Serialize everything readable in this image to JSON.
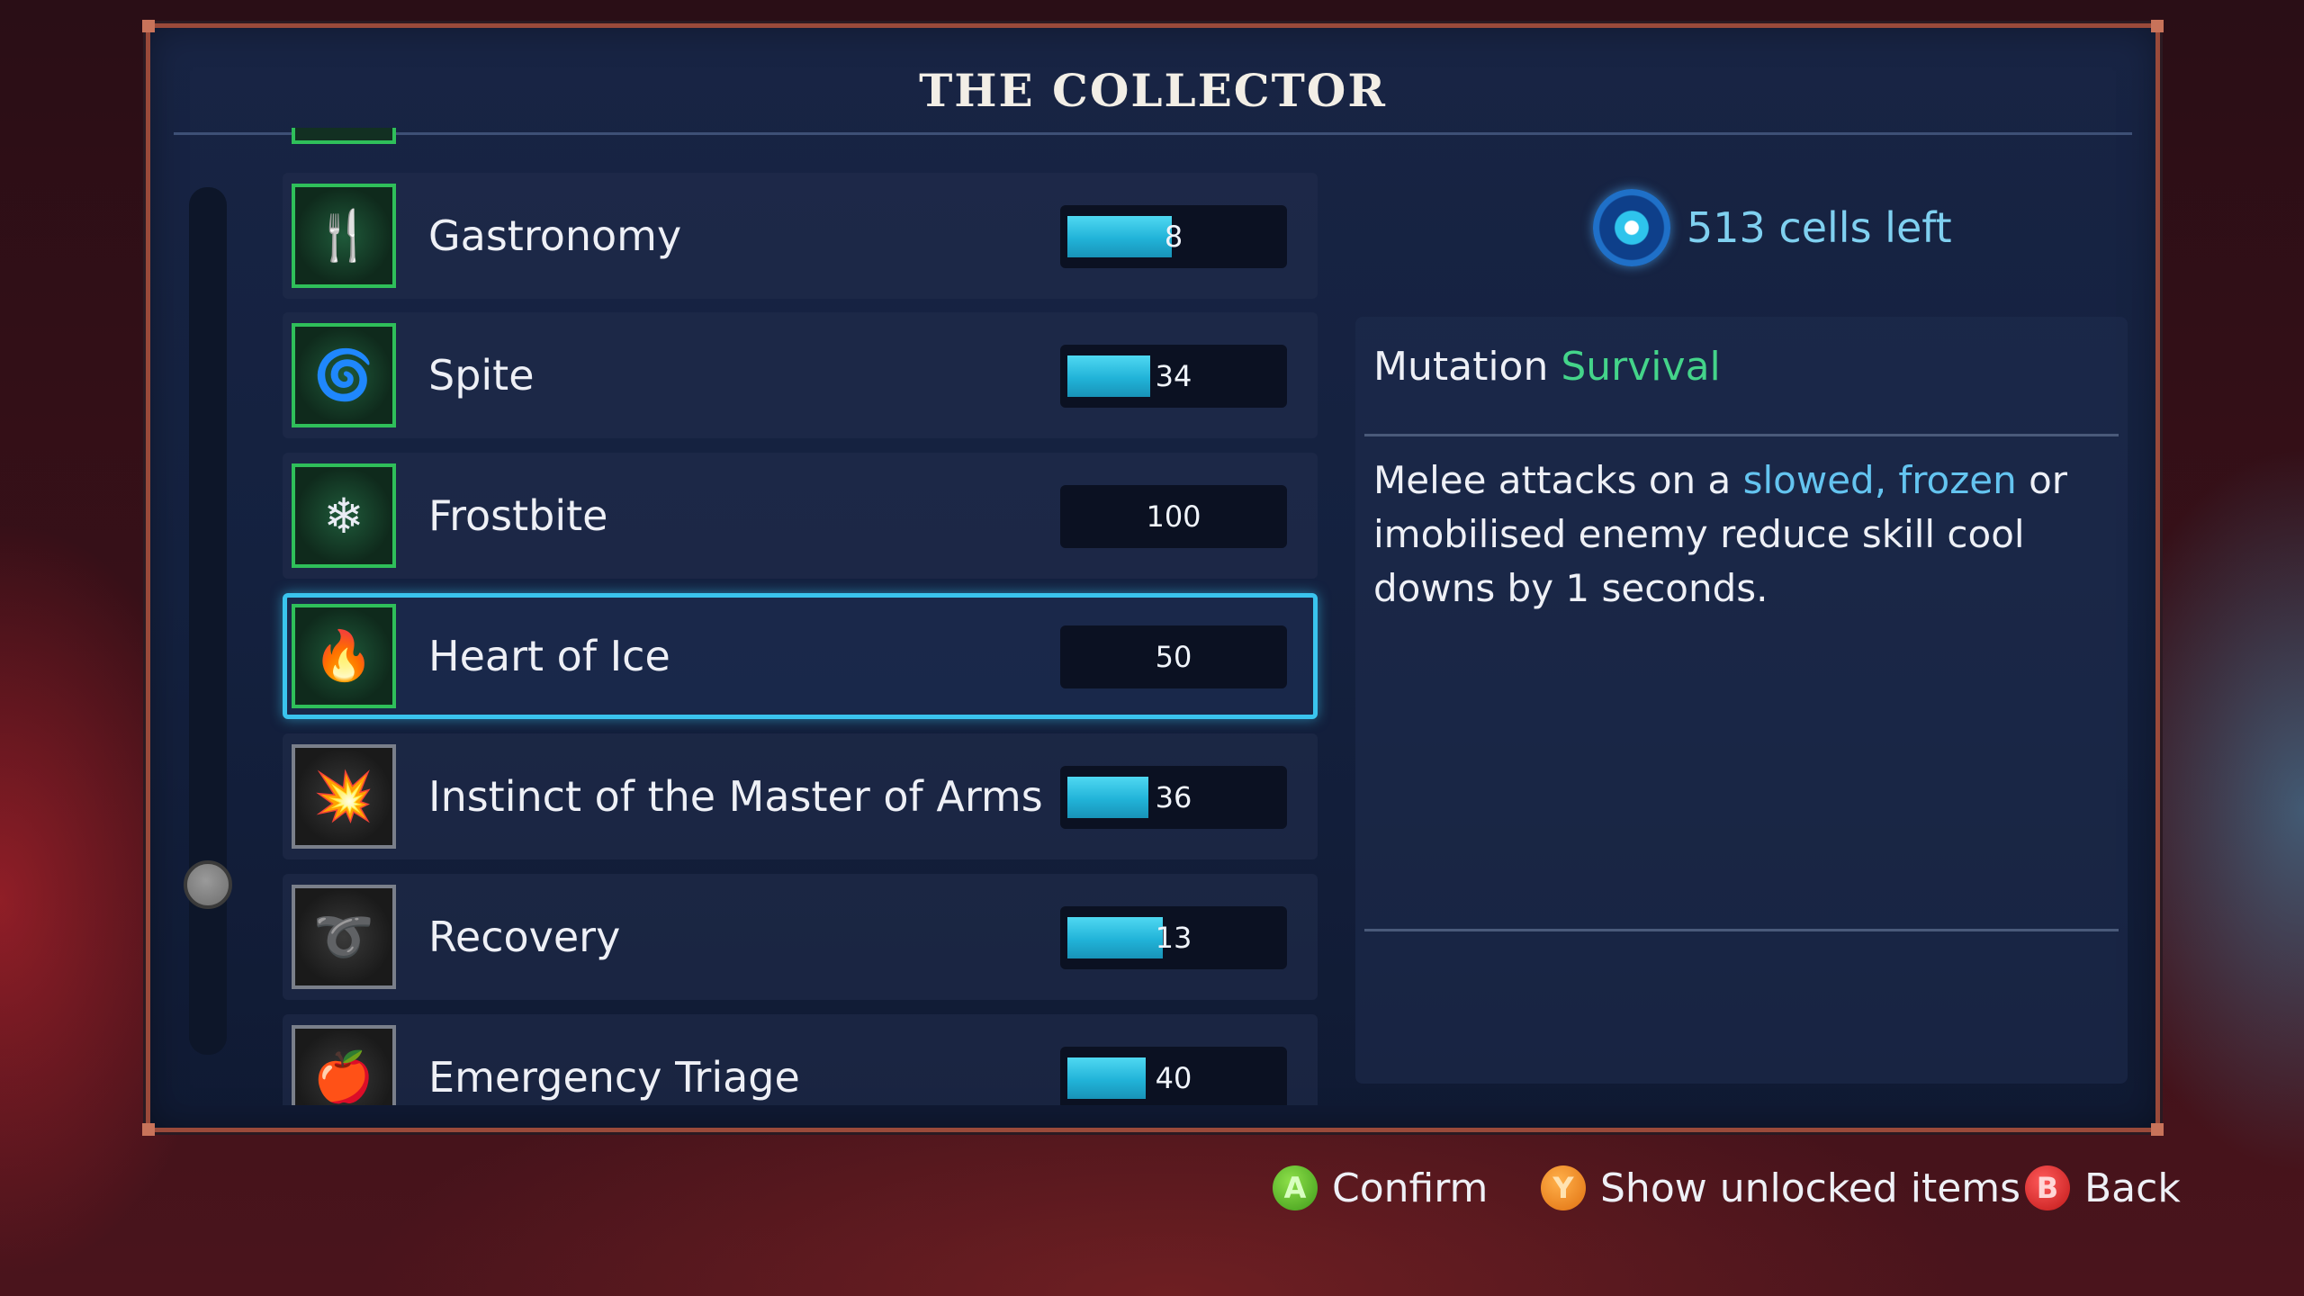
{
  "window": {
    "title": "THE COLLECTOR"
  },
  "items": [
    {
      "name": "Gastronomy",
      "icon": "gastronomy-icon",
      "value": "8",
      "progress": 0.49,
      "unlocked": true
    },
    {
      "name": "Spite",
      "icon": "spite-icon",
      "value": "34",
      "progress": 0.39,
      "unlocked": true
    },
    {
      "name": "Frostbite",
      "icon": "frostbite-icon",
      "value": "100",
      "progress": 0,
      "unlocked": true
    },
    {
      "name": "Heart of Ice",
      "icon": "heart-of-ice-icon",
      "value": "50",
      "progress": 0,
      "unlocked": true,
      "selected": true
    },
    {
      "name": "Instinct of the Master of Arms",
      "icon": "master-of-arms-icon",
      "value": "36",
      "progress": 0.38,
      "unlocked": false
    },
    {
      "name": "Recovery",
      "icon": "recovery-icon",
      "value": "13",
      "progress": 0.45,
      "unlocked": false
    },
    {
      "name": "Emergency Triage",
      "icon": "emergency-triage-icon",
      "value": "40",
      "progress": 0.37,
      "unlocked": false
    }
  ],
  "scroll": {
    "position": 0.82
  },
  "cells": {
    "text": "513 cells left",
    "icon": "cell-icon"
  },
  "detail": {
    "category": "Mutation",
    "type": "Survival",
    "desc_part1": "Melee attacks on a ",
    "desc_kw1": "slowed,",
    "desc_space": " ",
    "desc_kw2": "frozen",
    "desc_part2": " or imobilised enemy reduce skill cool downs by 1 seconds."
  },
  "footer": {
    "confirm": {
      "key": "A",
      "label": "Confirm"
    },
    "show_unlocked": {
      "key": "Y",
      "label": "Show unlocked items"
    },
    "back": {
      "key": "B",
      "label": "Back"
    }
  },
  "colors": {
    "accent": "#3ac4ee",
    "bar_fill": "#21b3d8",
    "unlocked_border": "#2fbf5a",
    "keyword_green": "#44d48a",
    "keyword_blue": "#64c4f0",
    "frame_border": "#9a4a3a"
  }
}
